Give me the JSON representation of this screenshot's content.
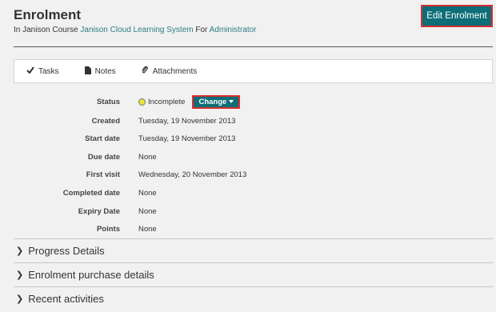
{
  "header": {
    "title": "Enrolment",
    "subtitle_prefix": "In Janison Course ",
    "course_link": "Janison Cloud Learning System",
    "subtitle_mid": " For ",
    "user_link": "Administrator",
    "edit_button": "Edit Enrolment"
  },
  "tabs": [
    {
      "label": "Tasks",
      "icon": "check-icon"
    },
    {
      "label": "Notes",
      "icon": "document-icon"
    },
    {
      "label": "Attachments",
      "icon": "paperclip-icon"
    }
  ],
  "details": {
    "status": {
      "label": "Status",
      "value": "Incomplete",
      "dot_color": "#e6e43a",
      "change_button": "Change"
    },
    "created": {
      "label": "Created",
      "value": "Tuesday, 19 November 2013"
    },
    "start_date": {
      "label": "Start date",
      "value": "Tuesday, 19 November 2013"
    },
    "due_date": {
      "label": "Due date",
      "value": "None"
    },
    "first_visit": {
      "label": "First visit",
      "value": "Wednesday, 20 November 2013"
    },
    "completed_date": {
      "label": "Completed date",
      "value": "None"
    },
    "expiry_date": {
      "label": "Expiry Date",
      "value": "None"
    },
    "points": {
      "label": "Points",
      "value": "None"
    }
  },
  "sections": [
    {
      "title": "Progress Details"
    },
    {
      "title": "Enrolment purchase details"
    },
    {
      "title": "Recent activities"
    }
  ],
  "colors": {
    "accent": "#0d6e78",
    "highlight_border": "#d9302f",
    "link": "#2e7b86"
  }
}
